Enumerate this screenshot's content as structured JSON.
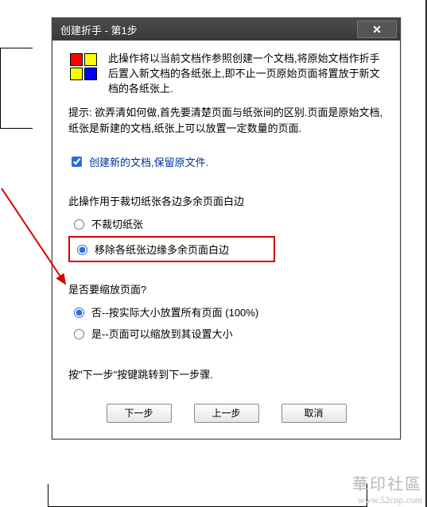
{
  "dialog": {
    "title": "创建折手 - 第1步",
    "close_glyph": "✕"
  },
  "intro": "此操作将以当前文档作参照创建一个文档,将原始文档作折手后置入新文档的各纸张上,即不止一页原始页面将置放于新文档的各纸张上.",
  "tip": "提示: 欲弄清如何做,首先要清楚页面与纸张间的区别.页面是原始文档,纸张是新建的文档,纸张上可以放置一定数量的页面.",
  "create_new": {
    "checked": true,
    "label": "创建新的文档,保留原文件."
  },
  "trim": {
    "section_label": "此操作用于裁切纸张各边多余页面白边",
    "opt_no": "不裁切纸张",
    "opt_yes": "移除各纸张边缘多余页面白边",
    "selected": "yes"
  },
  "scale": {
    "section_label": "是否要缩放页面?",
    "opt_no": "否--按实际大小放置所有页面 (100%)",
    "opt_yes": "是--页面可以缩放到其设置大小",
    "selected": "no"
  },
  "final_hint": "按\"下一步\"按键跳转到下一步骤.",
  "buttons": {
    "next": "下一步",
    "prev": "上一步",
    "cancel": "取消"
  },
  "watermark": {
    "cn": "華印社區",
    "url": "www.52cnp.com"
  }
}
